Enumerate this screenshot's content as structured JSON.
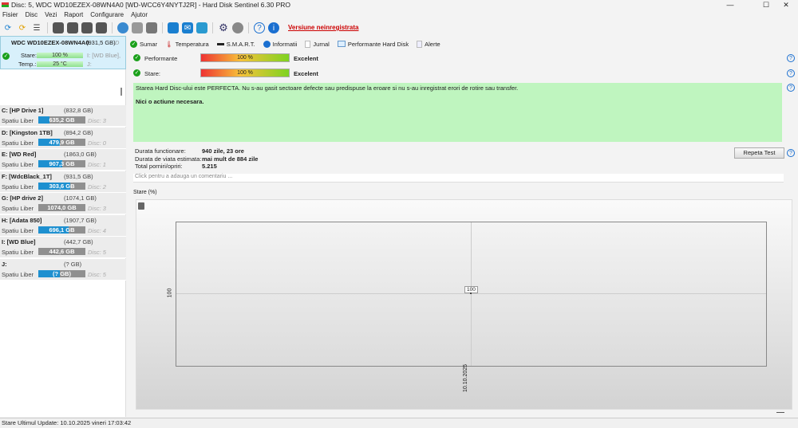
{
  "window": {
    "title": "Disc: 5, WDC WD10EZEX-08WN4A0 [WD-WCC6Y4NYTJ2R]  -  Hard Disk Sentinel 6.30 PRO",
    "minimize": "—",
    "maximize": "☐",
    "close": "✕"
  },
  "menu": [
    "Fisier",
    "Disc",
    "Vezi",
    "Raport",
    "Configurare",
    "Ajutor"
  ],
  "toolbar": {
    "unregistered": "Versiune neinregistrata"
  },
  "disk": {
    "name": "WDC WD10EZEX-08WN4A0",
    "size": "(931,5 GB)",
    "extra": "D",
    "stare_label": "Stare:",
    "stare_value": "100 %",
    "temp_label": "Temp.:",
    "temp_value": "25 °C",
    "vol1": "I: [WD Blue],",
    "vol2": "J:"
  },
  "volumes": [
    {
      "name": "C: [HP Drive 1]",
      "size": "(832,8 GB)",
      "label": "Spatiu Liber",
      "free": "635,2 GB",
      "used_fraction": 0.24,
      "disc": "Disc: 3"
    },
    {
      "name": "D: [Kingston 1TB]",
      "size": "(894,2 GB)",
      "label": "Spatiu Liber",
      "free": "479,9 GB",
      "used_fraction": 0.46,
      "disc": "Disc: 0"
    },
    {
      "name": "E: [WD Red]",
      "size": "(1863,0 GB)",
      "label": "Spatiu Liber",
      "free": "907,3 GB",
      "used_fraction": 0.51,
      "disc": "Disc: 1"
    },
    {
      "name": "F: [WdcBlack_1T]",
      "size": "(931,5 GB)",
      "label": "Spatiu Liber",
      "free": "303,6 GB",
      "used_fraction": 0.67,
      "disc": "Disc: 2"
    },
    {
      "name": "G: [HP drive 2]",
      "size": "(1074,1 GB)",
      "label": "Spatiu Liber",
      "free": "1074,0 GB",
      "used_fraction": 0.0,
      "disc": "Disc: 3"
    },
    {
      "name": "H: [Adata 850]",
      "size": "(1907,7 GB)",
      "label": "Spatiu Liber",
      "free": "696,1 GB",
      "used_fraction": 0.64,
      "disc": "Disc: 4"
    },
    {
      "name": "I: [WD Blue]",
      "size": "(442,7 GB)",
      "label": "Spatiu Liber",
      "free": "442,6 GB",
      "used_fraction": 0.0,
      "disc": "Disc: 5"
    },
    {
      "name": "J:",
      "size": "(? GB)",
      "label": "Spatiu Liber",
      "free": "(? GB)",
      "used_fraction": 0.45,
      "disc": "Disc: 5"
    }
  ],
  "tabs": [
    "Sumar",
    "Temperatura",
    "S.M.A.R.T.",
    "Informatii",
    "Jurnal",
    "Performante Hard Disk",
    "Alerte"
  ],
  "summary": {
    "perf_label": "Performante",
    "perf_value": "100 %",
    "perf_percent": 100,
    "perf_rating": "Excelent",
    "stare_label": "Stare:",
    "stare_value": "100 %",
    "stare_percent": 100,
    "stare_rating": "Excelent",
    "message": "Starea Hard Disc-ului este PERFECTA. Nu s-au gasit sectoare defecte sau predispuse la eroare si nu s-au inregistrat erori de rotire sau transfer.",
    "action": "Nici o actiune necesara.",
    "uptime_label": "Durata functionare:",
    "uptime": "940 zile, 23 ore",
    "life_label": "Durata de viata estimata:",
    "life": "mai mult de 884 zile",
    "starts_label": "Total porniri/opriri:",
    "starts": "5.215",
    "retest": "Repeta Test",
    "comment_placeholder": "Click pentru a adauga un comentariu ..."
  },
  "chart_data": {
    "type": "line",
    "title": "Stare (%)",
    "x": [
      "10.10.2025"
    ],
    "values": [
      100
    ],
    "ylabel": "",
    "xlabel": "",
    "y_tick": "100",
    "point_label": "100"
  },
  "status": "Stare Ultimul Update: 10.10.2025 vineri 17:03:42"
}
